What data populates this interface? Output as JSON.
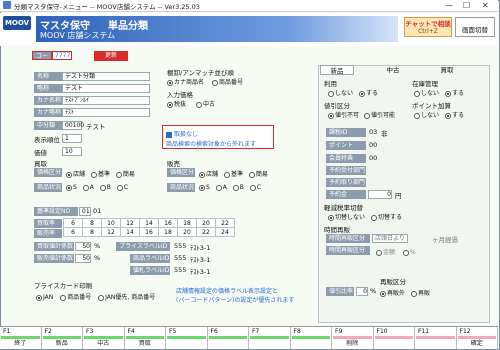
{
  "window": {
    "title": "分類マスタ保守-メニュー -- MOOV店舗システム -- Ver3.25.03"
  },
  "header": {
    "logo": "MOOV",
    "title1": "マスタ保守",
    "title2": "単品分類",
    "subtitle": "MOOV 店舗システム",
    "chat_label": "チャットで相談",
    "chat_key": "Ctrl+Z",
    "screen_label": "画面切替"
  },
  "code": {
    "label": "コード",
    "value": "7777",
    "update": "更新"
  },
  "left": {
    "name_label": "名称",
    "name_value": "テスト分類",
    "short_label": "略称",
    "short_value": "テスト",
    "kana_label": "カナ名称",
    "kana_value": "ﾃｽﾄﾌﾞﾝﾙｲ",
    "kana_short_label": "カナ略称",
    "kana_short_value": "ﾃｽﾄ",
    "mid_label": "中分類",
    "mid_code": "00100",
    "mid_value": "テスト",
    "disp_label": "表示順位",
    "disp_value": "1",
    "tax_label": "価値",
    "tax_value": "10"
  },
  "sort": {
    "title": "棚卸/アンマッチ並び順",
    "opt1": "カナ商品名",
    "opt2": "商品番号",
    "input_title": "入力価格",
    "in1": "税抜",
    "in2": "中古"
  },
  "notice": {
    "check_label": "取扱なし",
    "text": "商品検索の検索対象から外れます"
  },
  "buy": {
    "title": "買取",
    "price_label": "価格区分",
    "price_opts": [
      "店舗",
      "基準",
      "簡易"
    ],
    "status_label": "商品状況",
    "status_opts": [
      "S",
      "A",
      "B",
      "C"
    ]
  },
  "sell": {
    "title": "販売",
    "price_label": "価格区分",
    "price_opts": [
      "店舗",
      "基準",
      "簡易"
    ],
    "status_label": "商品状況",
    "status_opts": [
      "S",
      "A",
      "B",
      "C"
    ]
  },
  "table": {
    "master_label": "基準設定NO",
    "master_code": "01",
    "master_value": "01",
    "buy_rate_label": "買取率",
    "buy_rates": [
      "6",
      "8",
      "10",
      "12",
      "14",
      "16",
      "18",
      "20",
      "22"
    ],
    "sell_rate_label": "販売率",
    "sell_rates": [
      "6",
      "8",
      "12",
      "14",
      "16",
      "18",
      "20",
      "22",
      "24"
    ]
  },
  "pct": {
    "buy_label": "買取値計係数",
    "buy_value": "50",
    "sell_label": "販売値計係数",
    "sell_value": "50",
    "unit": "%"
  },
  "price_labels": [
    {
      "label": "プライスラベルID",
      "code": "555",
      "name": "ﾃｽﾄ3-1"
    },
    {
      "label": "商品ラベルID",
      "code": "555",
      "name": "ﾃｽﾄ3-1"
    },
    {
      "label": "値札ラベルID",
      "code": "555",
      "name": "ﾃｽﾄ3-1"
    }
  ],
  "price_card": {
    "title": "プライスカード印刷",
    "opts": [
      "JAN",
      "商品番号",
      "JAN優先, 商品番号"
    ],
    "note1": "店舗情報設定の価格ラベル表示設定と",
    "note2": "(バーコードパターン)の設定が優先されます"
  },
  "right": {
    "tabs": [
      "新品",
      "中古",
      "買取"
    ],
    "use_label": "利用",
    "use_opts": [
      "しない",
      "する"
    ],
    "stock_label": "在庫管理",
    "stock_opts": [
      "しない",
      "する"
    ],
    "discount_label": "値引区分",
    "discount_opts": [
      "値引不可",
      "値引可能"
    ],
    "point_label": "ポイント加算",
    "point_opts": [
      "しない",
      "する"
    ],
    "rows": [
      {
        "label": "課税ID",
        "code": "03",
        "value": "非"
      },
      {
        "label": "ポイント",
        "code": "00",
        "value": ""
      },
      {
        "label": "会員特典",
        "code": "00",
        "value": ""
      },
      {
        "label": "予約受付部門",
        "code": "",
        "value": ""
      },
      {
        "label": "予約取り部門",
        "code": "",
        "value": ""
      },
      {
        "label": "予約金",
        "code": "0",
        "value": "円"
      }
    ],
    "tax_label": "軽減税率切替",
    "tax_opts": [
      "切替しない",
      "切替する"
    ],
    "sale_title": "時間再販",
    "resale_label": "時間再販区分",
    "resale_value": "店頭日より",
    "months": "ヶ月経過",
    "resale_price_label": "時間再販区分",
    "resale_opts": [
      "金額",
      "%"
    ],
    "resale2_title": "再販区分",
    "resale2_opts": [
      "再販外",
      "再販"
    ],
    "std_label": "値引比率",
    "std_value": "0",
    "std_unit": "%"
  },
  "fkeys": [
    {
      "key": "F1",
      "label": "終了",
      "color": "#6fd86a"
    },
    {
      "key": "F2",
      "label": "新品",
      "color": "#6fd86a"
    },
    {
      "key": "F3",
      "label": "中古",
      "color": "#6fd86a"
    },
    {
      "key": "F4",
      "label": "買取",
      "color": "#6fd86a"
    },
    {
      "key": "F5",
      "label": "",
      "color": "#6fd86a"
    },
    {
      "key": "F6",
      "label": "",
      "color": "#6fd86a"
    },
    {
      "key": "F7",
      "label": "",
      "color": "#6fd86a"
    },
    {
      "key": "F8",
      "label": "",
      "color": "#6fd86a"
    },
    {
      "key": "F9",
      "label": "削除",
      "color": "#f4a7b6"
    },
    {
      "key": "F10",
      "label": "",
      "color": "#f4a7b6"
    },
    {
      "key": "F11",
      "label": "",
      "color": "#f4a7b6"
    },
    {
      "key": "F12",
      "label": "確定",
      "color": "#f4a7b6"
    }
  ]
}
